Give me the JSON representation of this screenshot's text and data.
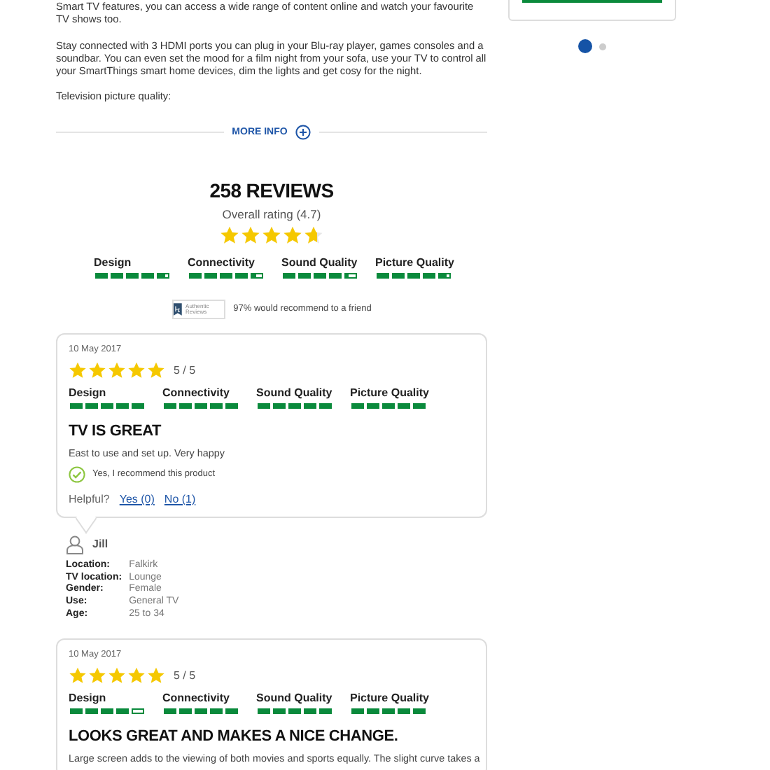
{
  "description": {
    "paragraphs": [
      "Smart TV features, you can access a wide range of content online and watch your favourite TV shows too.",
      "Stay connected with 3 HDMI ports you can plug in your Blu-ray player, games consoles and a soundbar. You can even set the mood for a film night from your sofa, use your TV to control all your SmartThings smart home devices, dim the lights and get cosy for the night.",
      "Television picture quality:"
    ]
  },
  "more_info": {
    "label": "MORE INFO"
  },
  "sidebar": {
    "pagination": [
      {
        "selected": true
      },
      {
        "selected": false
      }
    ]
  },
  "summary": {
    "title": "258 REVIEWS",
    "overall": "Overall rating (4.7)",
    "stars": 4.7,
    "ratings": [
      {
        "label": "Design",
        "level": 0.94
      },
      {
        "label": "Connectivity",
        "level": 0.9
      },
      {
        "label": "Sound Quality",
        "level": 0.88
      },
      {
        "label": "Picture Quality",
        "level": 0.95
      }
    ],
    "badge": "Authentic Reviews",
    "recommend": "97% would recommend to a friend"
  },
  "reviews": [
    {
      "date": "10 May 2017",
      "stars": 5,
      "score": "5 / 5",
      "ratings": [
        {
          "label": "Design",
          "level": 1
        },
        {
          "label": "Connectivity",
          "level": 1
        },
        {
          "label": "Sound Quality",
          "level": 1
        },
        {
          "label": "Picture Quality",
          "level": 1
        }
      ],
      "title": "TV IS GREAT",
      "body": "East to use and set up. Very happy",
      "recommended": true,
      "recommend_text": "Yes, I recommend this product",
      "helpful": {
        "label": "Helpful?",
        "yes": "Yes (0)",
        "no": "No (1)"
      },
      "reviewer": {
        "name": "Jill",
        "details": [
          {
            "label": "Location:",
            "value": "Falkirk"
          },
          {
            "label": "TV location:",
            "value": "Lounge"
          },
          {
            "label": "Gender:",
            "value": "Female"
          },
          {
            "label": "Use:",
            "value": "General TV"
          },
          {
            "label": "Age:",
            "value": "25 to 34"
          }
        ]
      }
    },
    {
      "date": "10 May 2017",
      "stars": 5,
      "score": "5 / 5",
      "ratings": [
        {
          "label": "Design",
          "level": 0.8
        },
        {
          "label": "Connectivity",
          "level": 1
        },
        {
          "label": "Sound Quality",
          "level": 1
        },
        {
          "label": "Picture Quality",
          "level": 1
        }
      ],
      "title": "LOOKS GREAT AND MAKES A NICE CHANGE.",
      "body": "Large screen adds to the viewing of both movies and sports equally. The slight curve takes a"
    }
  ]
}
